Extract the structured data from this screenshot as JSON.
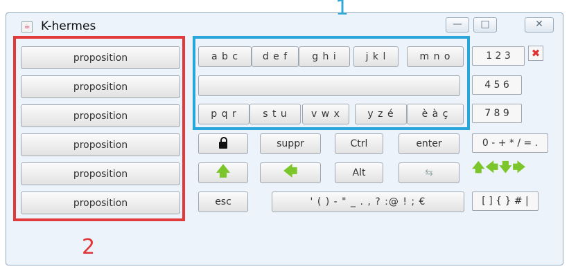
{
  "window": {
    "title": "K-hermes",
    "minimize": "—",
    "maximize": "□",
    "close": "✕"
  },
  "markers": {
    "one": "1",
    "two": "2"
  },
  "propositions": [
    "proposition",
    "proposition",
    "proposition",
    "proposition",
    "proposition",
    "proposition"
  ],
  "letters": {
    "row1": [
      "a b c",
      "d e f",
      "g h i",
      "j k l",
      "m n o"
    ],
    "row3": [
      "p q r",
      "s t u",
      "v w x",
      "y z é",
      "è à ç"
    ]
  },
  "numpad": {
    "row1": "1 2 3",
    "row2": "4 5 6",
    "row3": "7 8 9",
    "ops": "0 - + * / = .",
    "brackets": "[ ] { } # |"
  },
  "keys": {
    "suppr": "suppr",
    "ctrl": "Ctrl",
    "enter": "enter",
    "alt": "Alt",
    "esc": "esc",
    "punct": "' ( ) - \" _ . , ? :@ ! ; €",
    "up_arrow": "🡅",
    "left_arrow": "🡄",
    "tab_glyph": "⇆",
    "arrows": "🡅🡄🡇🡆"
  },
  "icons": {
    "lock": "lock-icon",
    "tools": "tools-icon"
  },
  "colors": {
    "highlight_blue": "#2aa5dc",
    "highlight_red": "#e23a3a",
    "arrow_green": "#7cc52a"
  }
}
